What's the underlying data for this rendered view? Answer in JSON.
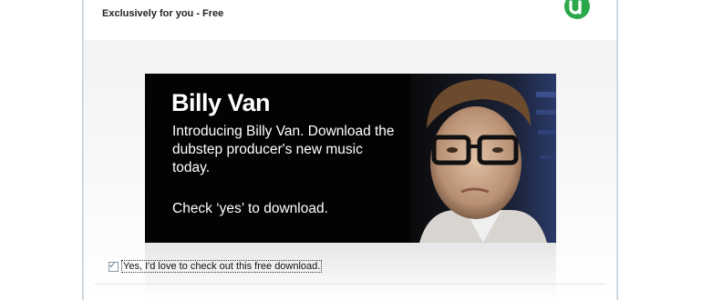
{
  "header": {
    "title": "Exclusively for you - Free",
    "logo_icon": "utorrent-logo-icon",
    "logo_color": "#2ba84a"
  },
  "ad": {
    "title": "Billy Van",
    "description": "Introducing Billy Van. Download the dubstep producer's new music today.",
    "cta": "Check ‘yes’ to download."
  },
  "optin": {
    "checked": true,
    "yes_label": "Yes,",
    "label": " I'd love to check out this free download."
  },
  "colors": {
    "ad_background": "#030303",
    "ad_text": "#ffffff"
  }
}
